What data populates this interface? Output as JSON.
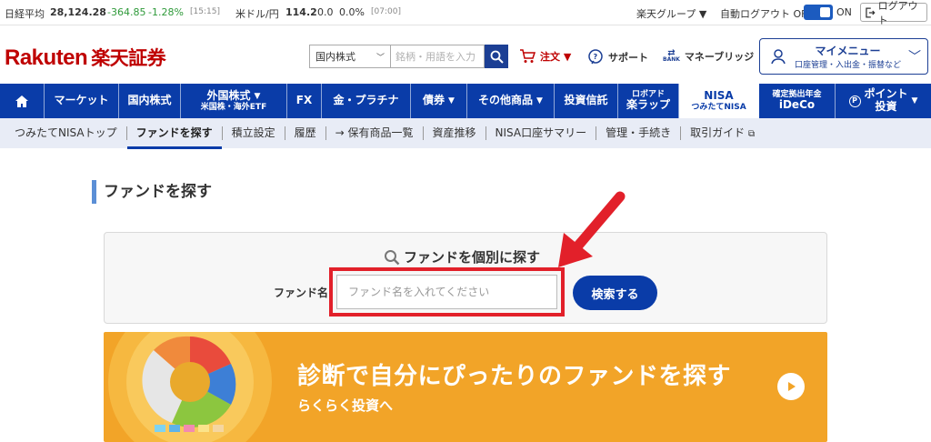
{
  "ticker": {
    "nikkei_label": "日経平均",
    "nikkei_value": "28,124.28",
    "nikkei_change": "-364.85",
    "nikkei_pct": "-1.28%",
    "nikkei_time": "[15:15]",
    "usdjpy_label": "米ドル/円",
    "usdjpy_value": "114.2",
    "usdjpy_change": "0.0",
    "usdjpy_pct": "0.0%",
    "usdjpy_time": "[07:00]",
    "group_label": "楽天グループ ▼",
    "autologout_label": "自動ログアウト OFF",
    "autologout_on": "ON",
    "logout_label": "ログアウト"
  },
  "header": {
    "logo_en": "Rakuten",
    "logo_jp": "楽天証券",
    "search_select": "国内株式",
    "search_placeholder": "銘柄・用語を入力",
    "order_label": "注文 ▼",
    "support_label": "サポート",
    "bridge_label": "マネーブリッジ",
    "bank_icon_text": "BANK",
    "mymenu_title": "マイメニュー",
    "mymenu_sub": "口座管理・入出金・振替など"
  },
  "mainnav": {
    "market": "マーケット",
    "domestic": "国内株式",
    "foreign_l1": "外国株式",
    "foreign_l2": "米国株・海外ETF",
    "fx": "FX",
    "gold": "金・プラチナ",
    "bond": "債券",
    "other": "その他商品",
    "trust": "投資信託",
    "robo_l1": "ロボアド",
    "robo_l2": "楽ラップ",
    "nisa_l1": "NISA",
    "nisa_l2": "つみたてNISA",
    "ideco_l1": "確定拠出年金",
    "ideco_l2": "iDeCo",
    "point_l1": "ポイント",
    "point_l2": "投資",
    "caret": "▼"
  },
  "subnav": {
    "items": [
      "つみたてNISAトップ",
      "ファンドを探す",
      "積立設定",
      "履歴",
      "→ 保有商品一覧",
      "資産推移",
      "NISA口座サマリー",
      "管理・手続き",
      "取引ガイド"
    ]
  },
  "page": {
    "title": "ファンドを探す",
    "box_title": "ファンドを個別に探す",
    "fund_name_label": "ファンド名",
    "fund_name_placeholder": "ファンド名を入れてください",
    "search_button": "検索する"
  },
  "banner": {
    "title": "診断で自分にぴったりのファンドを探す",
    "subtitle": "らくらく投資へ"
  },
  "colors": {
    "brand_red": "#bf0000",
    "nav_blue": "#0a3ca8",
    "highlight_red": "#e2202a",
    "banner_orange": "#f2a428"
  }
}
